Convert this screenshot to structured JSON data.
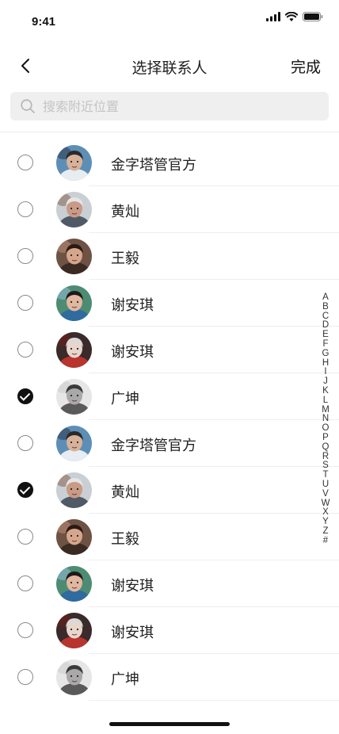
{
  "status_bar": {
    "time": "9:41"
  },
  "nav": {
    "title": "选择联系人",
    "done_label": "完成"
  },
  "search": {
    "placeholder": "搜索附近位置",
    "value": ""
  },
  "contacts": [
    {
      "name": "金字塔管官方",
      "checked": false,
      "avatar": "person-photo-1"
    },
    {
      "name": "黄灿",
      "checked": false,
      "avatar": "person-photo-2"
    },
    {
      "name": "王毅",
      "checked": false,
      "avatar": "person-photo-3"
    },
    {
      "name": "谢安琪",
      "checked": false,
      "avatar": "person-photo-4"
    },
    {
      "name": "谢安琪",
      "checked": false,
      "avatar": "person-photo-5"
    },
    {
      "name": "广坤",
      "checked": true,
      "avatar": "person-photo-6"
    },
    {
      "name": "金字塔管官方",
      "checked": false,
      "avatar": "person-photo-1"
    },
    {
      "name": "黄灿",
      "checked": true,
      "avatar": "person-photo-2"
    },
    {
      "name": "王毅",
      "checked": false,
      "avatar": "person-photo-3"
    },
    {
      "name": "谢安琪",
      "checked": false,
      "avatar": "person-photo-4"
    },
    {
      "name": "谢安琪",
      "checked": false,
      "avatar": "person-photo-5"
    },
    {
      "name": "广坤",
      "checked": false,
      "avatar": "person-photo-6"
    }
  ],
  "index_letters": [
    "A",
    "B",
    "C",
    "D",
    "E",
    "F",
    "G",
    "H",
    "I",
    "J",
    "K",
    "L",
    "M",
    "N",
    "O",
    "P",
    "Q",
    "R",
    "S",
    "T",
    "U",
    "V",
    "W",
    "X",
    "Y",
    "Z",
    "#"
  ],
  "colors": {
    "accent": "#111111",
    "search_bg": "#efefef",
    "divider": "#eeeeee",
    "placeholder": "#c4c4c4"
  }
}
